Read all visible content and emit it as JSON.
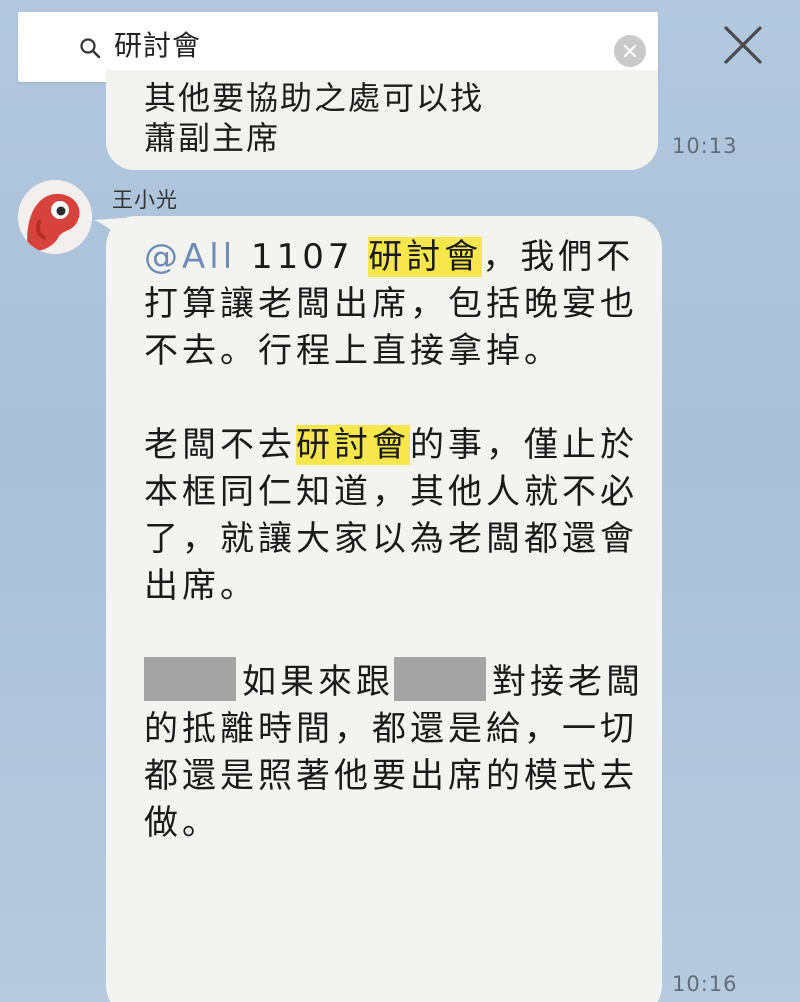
{
  "search": {
    "query": "研討會",
    "icon": "search-icon",
    "clear_icon": "clear-icon",
    "close_icon": "close-icon"
  },
  "previous_message": {
    "partial_line": "其他要協助之處可以找",
    "text": "蕭副主席",
    "time": "10:13"
  },
  "message": {
    "sender": "王小光",
    "avatar": "avatar",
    "mention": "@All",
    "highlight_term": "研討會",
    "p1_a": " 1107 ",
    "p1_b": "，我們不打算讓老闆出席，包括晚宴也不去。行程上直接拿掉。",
    "p2_a": "老闆不去",
    "p2_b": "的事，僅止於本框同仁知道，其他人就不必了，就讓大家以為老闆都還會出席。",
    "p3_a": "如果來跟",
    "p3_b": "對接老闆的抵離時間，都還是給，一切都還是照著他要出席的模式去做。",
    "time": "10:16"
  },
  "colors": {
    "background": "#aec4db",
    "bubble": "#f3f3f1",
    "highlight": "#f8e64d",
    "mention": "#6f8db4",
    "redaction": "#a4a4a4"
  }
}
